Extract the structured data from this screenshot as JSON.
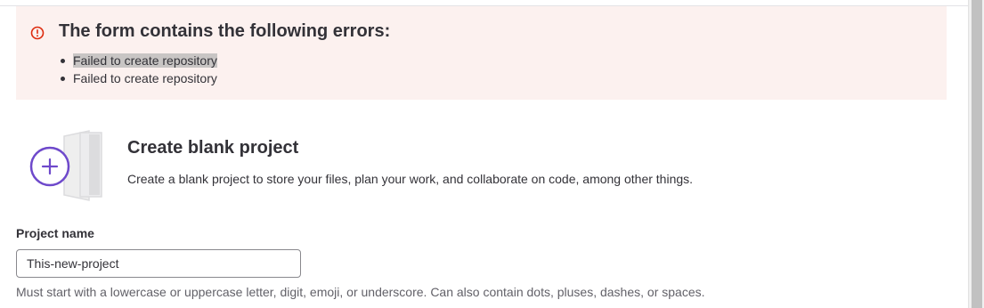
{
  "error_alert": {
    "title": "The form contains the following errors:",
    "errors": [
      "Failed to create repository",
      "Failed to create repository"
    ],
    "icon": "error-circle-icon",
    "color": "#dd2b0e",
    "background": "#fcf1ef"
  },
  "blank_project": {
    "icon": "add-project-icon",
    "title": "Create blank project",
    "description": "Create a blank project to store your files, plan your work, and collaborate on code, among other things."
  },
  "project_name": {
    "label": "Project name",
    "value": "This-new-project",
    "help": "Must start with a lowercase or uppercase letter, digit, emoji, or underscore. Can also contain dots, pluses, dashes, or spaces."
  },
  "accent_color": "#6e49cb"
}
